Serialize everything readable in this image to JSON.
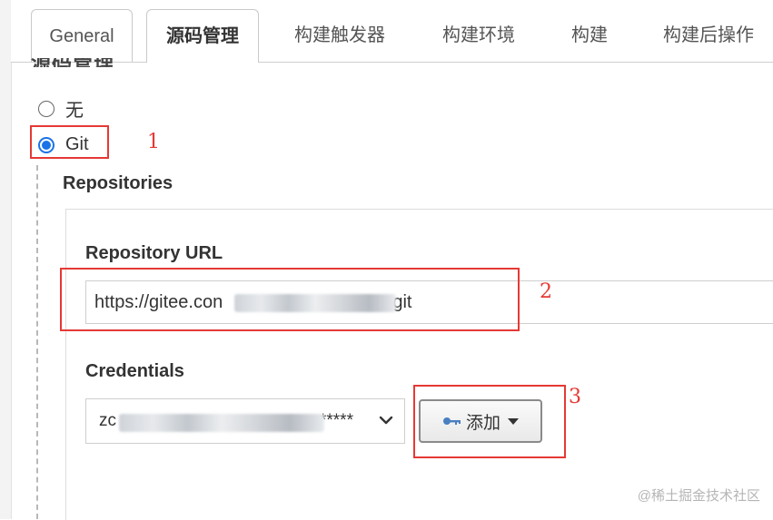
{
  "tabs": [
    "General",
    "源码管理",
    "构建触发器",
    "构建环境",
    "构建",
    "构建后操作"
  ],
  "section_heading": "源码管理",
  "scm_options": {
    "none": "无",
    "git": "Git"
  },
  "repositories": {
    "heading": "Repositories",
    "url_label": "Repository URL",
    "url_prefix": "https://gitee.con",
    "url_suffix": "r.git",
    "credentials_label": "Credentials",
    "credentials_prefix": "zc",
    "credentials_suffix": "*****",
    "add_button": "添加"
  },
  "annotations": [
    "1",
    "2",
    "3"
  ],
  "watermark": "@稀土掘金技术社区",
  "colors": {
    "annotation_red": "#e53935",
    "radio_blue": "#1a73e8"
  }
}
